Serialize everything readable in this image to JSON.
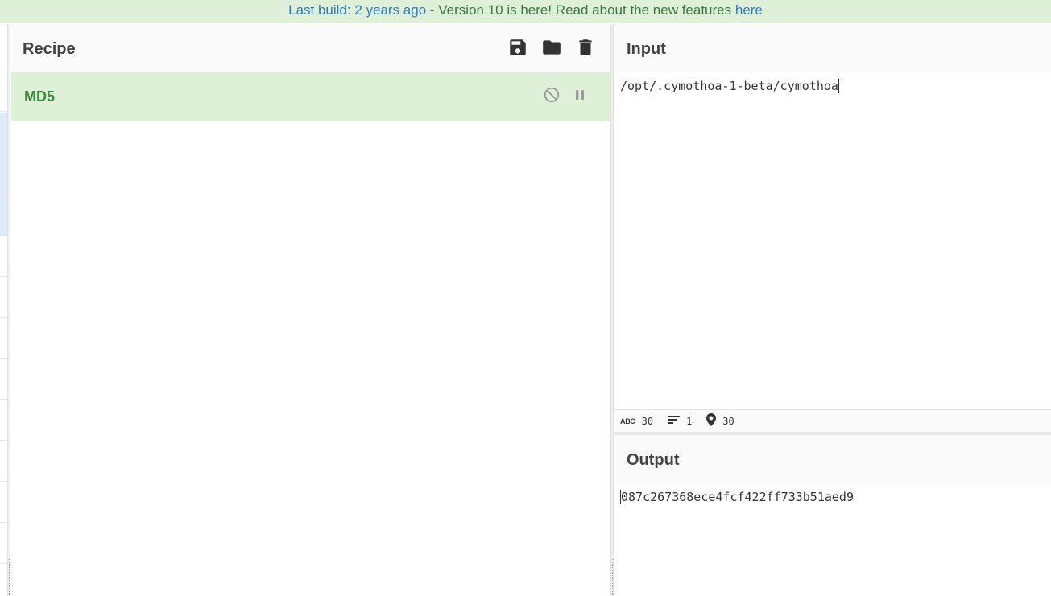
{
  "banner": {
    "last_build": "Last build: 2 years ago",
    "separator": " - ",
    "message": "Version 10 is here! Read about the new features ",
    "link": "here"
  },
  "recipe": {
    "title": "Recipe",
    "icons": [
      "save-icon",
      "folder-icon",
      "trash-icon"
    ],
    "operations": [
      {
        "name": "MD5",
        "controls": [
          "disable-icon",
          "breakpoint-icon"
        ]
      }
    ]
  },
  "input": {
    "title": "Input",
    "value": "/opt/.cymothoa-1-beta/cymothoa",
    "status": {
      "length_label": "ABC",
      "length": "30",
      "lines": "1",
      "position": "30"
    }
  },
  "output": {
    "title": "Output",
    "value": "087c267368ece4fcf422ff733b51aed9"
  },
  "colors": {
    "banner_bg": "#dff0d8",
    "link": "#2e7bc4",
    "banner_text": "#3c763d",
    "operation_bg": "#dff0d8",
    "operation_text": "#3c8a3c"
  }
}
